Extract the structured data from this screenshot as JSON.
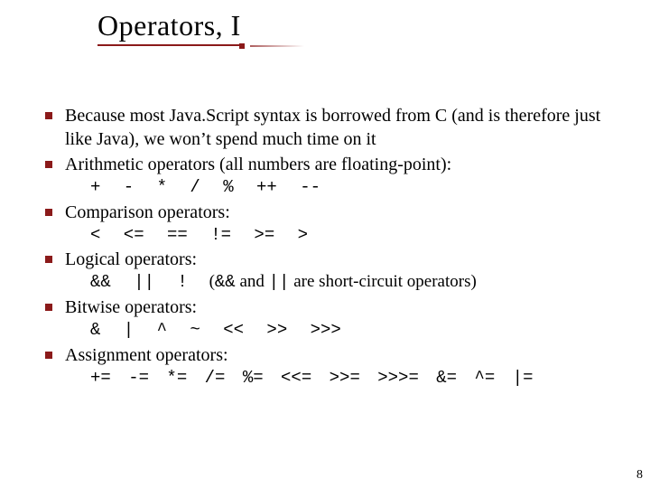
{
  "title": "Operators, I",
  "bullets": [
    {
      "text": "Because most Java.Script syntax is borrowed from C (and is therefore just like Java), we won’t spend much time on it"
    },
    {
      "text": "Arithmetic operators (all numbers are floating-point):",
      "opsline": "+   -   *   /   %   ++   --"
    },
    {
      "text": "Comparison operators:",
      "opsline": "<   <=   ==   !=   >=   >"
    },
    {
      "text": "Logical operators:",
      "logical": {
        "ops": "&&   ||   !",
        "note_pre": "(",
        "and_tok": "&&",
        "and_word": " and ",
        "or_tok": "||",
        "note_post_a": " are ",
        "note_emph": "short-circuit",
        "note_post_b": " operators)"
      }
    },
    {
      "text": "Bitwise operators:",
      "opsline": "&   |   ^   ~   <<   >>   >>>"
    },
    {
      "text": "Assignment operators:",
      "opsline": "+=  -=  *=  /=  %=   <<=  >>=  >>>=  &=  ^=  |="
    }
  ],
  "page_number": "8"
}
